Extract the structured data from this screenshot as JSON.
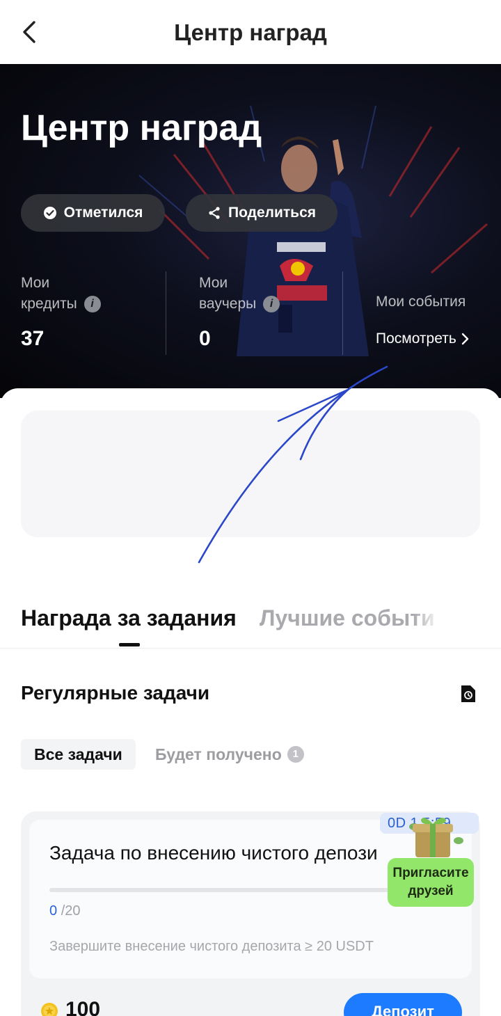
{
  "header": {
    "title": "Центр наград"
  },
  "hero": {
    "title": "Центр наград",
    "checkin_label": "Отметился",
    "share_label": "Поделиться",
    "credits": {
      "label_line1": "Мои",
      "label_line2": "кредиты",
      "value": "37"
    },
    "vouchers": {
      "label_line1": "Мои",
      "label_line2": "ваучеры",
      "value": "0"
    },
    "events": {
      "label": "Мои события",
      "link": "Посмотреть"
    }
  },
  "tabs": [
    {
      "label": "Награда за задания",
      "active": true
    },
    {
      "label": "Лучшие событи",
      "active": false
    }
  ],
  "tasks_section": {
    "title": "Регулярные задачи",
    "filter_all": "Все задачи",
    "filter_received": "Будет получено",
    "received_count": "1"
  },
  "task": {
    "title": "Задача по внесению чистого депози",
    "progress_current": "0",
    "progress_total": "/20",
    "progress_fraction": 0,
    "description": "Завершите внесение чистого депозита ≥ 20 USDT",
    "reward": "100",
    "button_label": "Депозит"
  },
  "promo": {
    "timer": "0D 1 5:59",
    "invite_line1": "Пригласите",
    "invite_line2": "друзей"
  },
  "colors": {
    "accent_blue": "#1d7bff",
    "invite_green": "#92e76a",
    "annotation_stroke": "#2b47c9"
  }
}
